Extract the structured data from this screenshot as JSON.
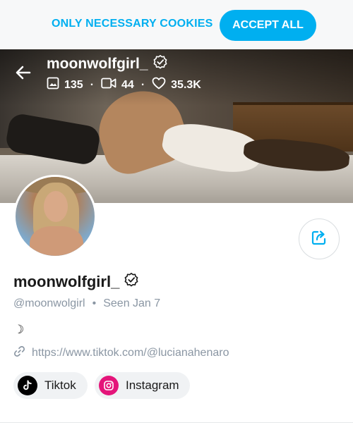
{
  "cookie_bar": {
    "necessary_label": "ONLY NECESSARY COOKIES",
    "accept_label": "ACCEPT ALL"
  },
  "header": {
    "username": "moonwolfgirl_",
    "stats": {
      "photos": "135",
      "videos": "44",
      "likes": "35.3K"
    }
  },
  "profile": {
    "display_name": "moonwolfgirl_",
    "handle": "@moonwolgirl",
    "separator": "•",
    "last_seen": "Seen  Jan 7",
    "bio": "☽",
    "link": "https://www.tiktok.com/@lucianahenaro"
  },
  "socials": [
    {
      "label": "Tiktok",
      "icon": "tiktok-icon"
    },
    {
      "label": "Instagram",
      "icon": "instagram-icon"
    }
  ],
  "colors": {
    "accent": "#00aff0",
    "muted_text": "#8a96a3",
    "instagram": "#e4157a"
  }
}
